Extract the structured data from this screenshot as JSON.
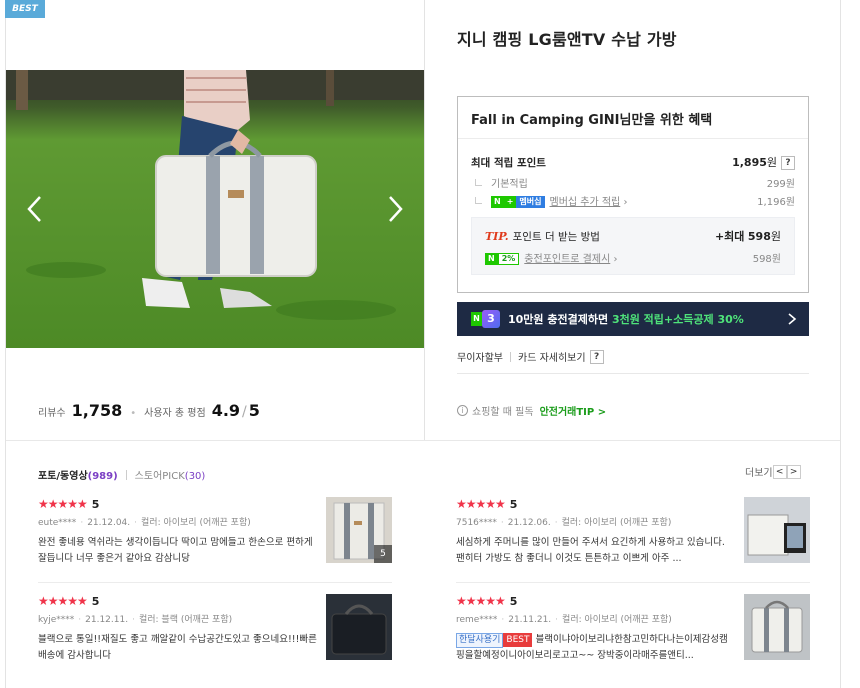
{
  "badge": "BEST",
  "product": {
    "title": "지니 캠핑 LG룸앤TV 수납 가방"
  },
  "benefit": {
    "heading": "Fall in Camping GINI님만을 위한 혜택",
    "max_points_label": "최대 적립 포인트",
    "max_points_value": "1,895",
    "won": "원",
    "basic_label": "기본적립",
    "basic_value": "299원",
    "npay_badge_n": "N",
    "npay_badge_plus": "+",
    "npay_badge_membership": "멤버십",
    "membership_label": "멤버십 추가 적립",
    "membership_value": "1,196원",
    "tip_label": "TIP.",
    "tip_text": "포인트 더 받는 방법",
    "tip_max": "+최대",
    "tip_max_value": "598",
    "charge_badge_n": "N",
    "charge_badge_pct": "2%",
    "charge_label": "충전포인트로 결제시",
    "charge_value": "598원",
    "question_mark": "?"
  },
  "promo": {
    "n": "N",
    "num": "3",
    "text_main": "10만원 충전결제하면",
    "text_highlight": "3천원 적립",
    "text_tail": "+소득공제 30%"
  },
  "paylinks": {
    "installment": "무이자할부",
    "card_detail": "카드 자세히보기",
    "question_mark": "?"
  },
  "stats": {
    "review_count_label": "리뷰수",
    "review_count": "1,758",
    "avg_label": "사용자 총 평점",
    "avg_score": "4.9",
    "slash": "/",
    "avg_max": "5"
  },
  "safe": {
    "info": "i",
    "text": "쇼핑할 때 필독",
    "link": "안전거래TIP >"
  },
  "tabs": [
    {
      "label": "포토/동영상",
      "count": "(989)"
    },
    {
      "label": "스토어PICK",
      "count": "(30)"
    }
  ],
  "more": {
    "label": "더보기",
    "prev": "<",
    "next": ">"
  },
  "reviews": [
    {
      "score": "5",
      "user": "eute****",
      "date": "21.12.04.",
      "option": "컬러: 아이보리 (어깨끈 포함)",
      "text": "완전 좋네용 역쉬라는 생각이듭니다 딱이고 맘에들고 한손으로 편하게 잘듭니다 너무 좋은거 같아요 감삼니당",
      "photo_count": "5"
    },
    {
      "score": "5",
      "user": "7516****",
      "date": "21.12.06.",
      "option": "컬러: 아이보리 (어깨끈 포함)",
      "text": "세심하게 주머니를 많이 만들어 주셔서 요긴하게 사용하고 있습니다. 팬히터 가방도 참 좋더니 이것도 튼튼하고 이쁘게 아주 ..."
    },
    {
      "score": "5",
      "user": "kyje****",
      "date": "21.12.11.",
      "option": "컬러: 블랙 (어깨끈 포함)",
      "text": "블랙으로 통일!!재질도 좋고 깨알같이 수납공간도있고 좋으네요!!!빠른배송에 감사합니다"
    },
    {
      "score": "5",
      "user": "reme****",
      "date": "21.11.21.",
      "option": "컬러: 아이보리 (어깨끈 포함)",
      "tag1": "한달사용기",
      "tag2": "BEST",
      "text": "블랙이냐아이보리냐한참고민하다나는이제감성캠핑을할예정이니아이보리로고고~~ 장박중이라매주를앤티..."
    }
  ],
  "star_glyphs": "★★★★★"
}
